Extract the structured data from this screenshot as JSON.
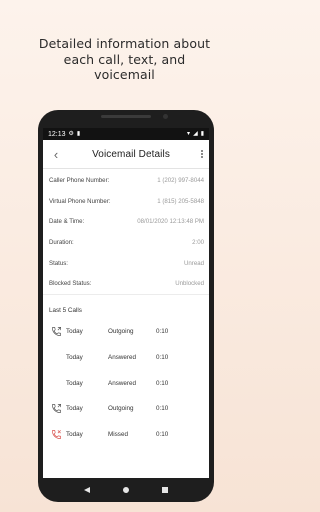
{
  "headline": {
    "line1": "Detailed information about",
    "line2": "each call, text, and",
    "line3": "voicemail"
  },
  "statusbar": {
    "time": "12:13"
  },
  "appbar": {
    "title": "Voicemail Details"
  },
  "details": [
    {
      "label": "Caller Phone Number:",
      "value": "1 (202) 997-8044"
    },
    {
      "label": "Virtual Phone Number:",
      "value": "1 (815) 205-5848"
    },
    {
      "label": "Date & Time:",
      "value": "08/01/2020 12:13:48 PM"
    },
    {
      "label": "Duration:",
      "value": "2:00"
    },
    {
      "label": "Status:",
      "value": "Unread"
    },
    {
      "label": "Blocked Status:",
      "value": "Unblocked"
    }
  ],
  "last_calls": {
    "heading": "Last 5 Calls",
    "rows": [
      {
        "icon": "outgoing-call-icon",
        "day": "Today",
        "type": "Outgoing",
        "duration": "0:10"
      },
      {
        "icon": "",
        "day": "Today",
        "type": "Answered",
        "duration": "0:10"
      },
      {
        "icon": "",
        "day": "Today",
        "type": "Answered",
        "duration": "0:10"
      },
      {
        "icon": "outgoing-call-icon",
        "day": "Today",
        "type": "Outgoing",
        "duration": "0:10"
      },
      {
        "icon": "missed-call-icon",
        "day": "Today",
        "type": "Missed",
        "duration": "0:10"
      }
    ]
  },
  "colors": {
    "background": "#f9e9de",
    "missed": "#d9534f"
  }
}
